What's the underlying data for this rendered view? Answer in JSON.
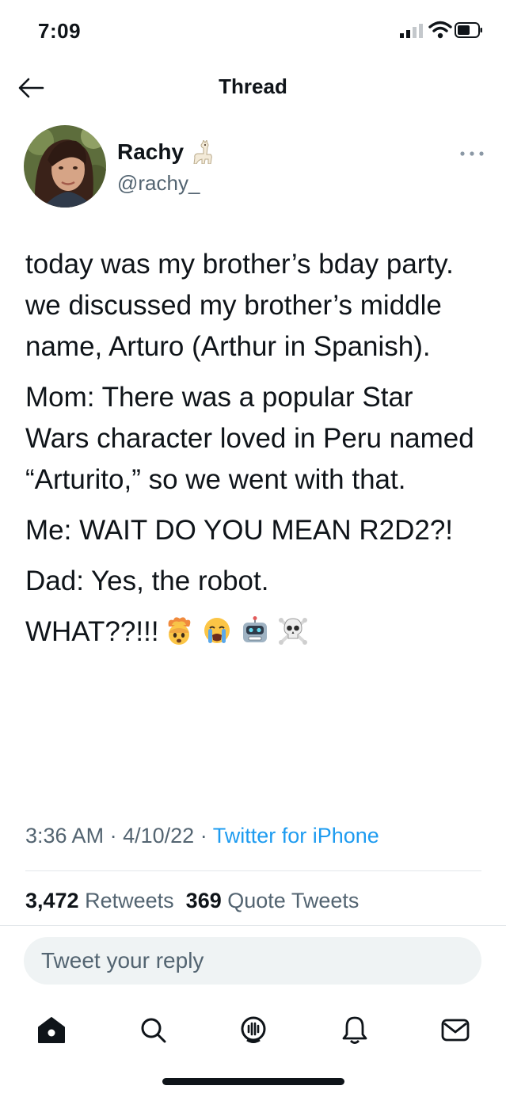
{
  "status_bar": {
    "time": "7:09",
    "icons": [
      "cellular-signal-icon",
      "wifi-icon",
      "battery-icon"
    ]
  },
  "nav": {
    "title": "Thread",
    "back_icon": "arrow-left-icon"
  },
  "tweet": {
    "author": {
      "name": "Rachy",
      "name_emoji": "llama-icon",
      "handle": "@rachy_"
    },
    "more_icon": "more-dots-icon",
    "paragraphs": [
      "today was my brother’s bday party. we discussed my brother’s middle name, Arturo (Arthur in Spanish).",
      "Mom: There was a popular Star Wars character loved in Peru named “Arturito,” so we went with that.",
      "Me: WAIT DO YOU MEAN R2D2?!",
      "Dad: Yes, the robot."
    ],
    "last_line": "WHAT??!!!",
    "last_line_emojis": [
      "exploding-head-icon",
      "crying-face-icon",
      "robot-icon",
      "skull-crossbones-icon"
    ],
    "time": "3:36 AM",
    "date": "4/10/22",
    "separator": "·",
    "source": "Twitter for iPhone",
    "retweets": {
      "count": "3,472",
      "label": "Retweets"
    },
    "quote_tweets": {
      "count": "369",
      "label": "Quote Tweets"
    }
  },
  "reply": {
    "placeholder": "Tweet your reply"
  },
  "tab_bar": {
    "tabs": [
      "home-icon",
      "search-icon",
      "spaces-icon",
      "notifications-icon",
      "messages-icon"
    ]
  },
  "colors": {
    "text": "#0f1419",
    "secondary": "#536471",
    "link": "#1d9bf0",
    "reply_bg": "#eff3f4",
    "divider": "#e3e7ea"
  }
}
